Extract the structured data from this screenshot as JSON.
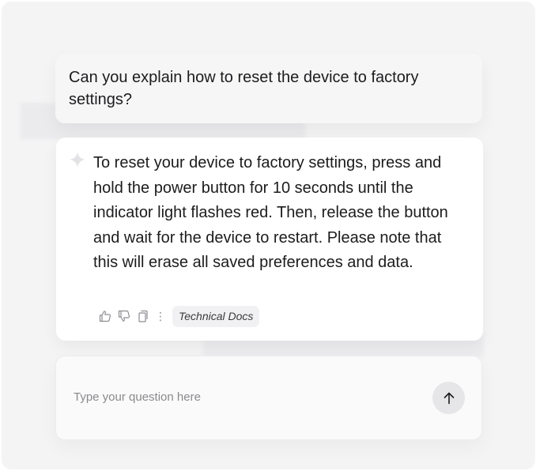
{
  "conversation": {
    "user_message": "Can you explain how to reset the device to factory settings?",
    "assistant_message": "To reset your device to factory settings, press and hold the power button for 10 seconds until the indicator light flashes red. Then, release the button and wait for the device to restart. Please note that this will erase all saved preferences and data.",
    "source_tag": "Technical Docs",
    "more_glyph": "⋮"
  },
  "composer": {
    "placeholder": "Type your question here",
    "value": ""
  },
  "icons": {
    "assistant": "sparkle-icon",
    "like": "thumbs-up-icon",
    "dislike": "thumbs-down-icon",
    "copy": "copy-icon",
    "more": "more-vertical-icon",
    "send": "arrow-up-icon"
  },
  "colors": {
    "background": "#f4f4f5",
    "card": "#ffffff",
    "text": "#1c1c1e",
    "muted": "#8e8e93",
    "send_button": "#e6e6e8"
  }
}
